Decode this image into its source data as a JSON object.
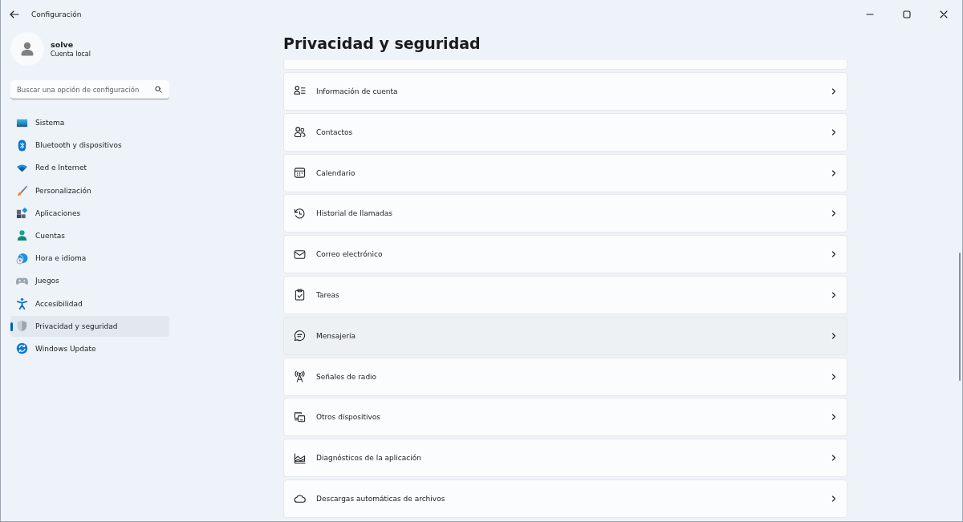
{
  "window": {
    "title": "Configuración"
  },
  "account": {
    "name": "solve",
    "type": "Cuenta local"
  },
  "search": {
    "placeholder": "Buscar una opción de configuración"
  },
  "sidebar": {
    "items": [
      {
        "label": "Sistema",
        "selected": false
      },
      {
        "label": "Bluetooth y dispositivos",
        "selected": false
      },
      {
        "label": "Red e Internet",
        "selected": false
      },
      {
        "label": "Personalización",
        "selected": false
      },
      {
        "label": "Aplicaciones",
        "selected": false
      },
      {
        "label": "Cuentas",
        "selected": false
      },
      {
        "label": "Hora e idioma",
        "selected": false
      },
      {
        "label": "Juegos",
        "selected": false
      },
      {
        "label": "Accesibilidad",
        "selected": false
      },
      {
        "label": "Privacidad y seguridad",
        "selected": true
      },
      {
        "label": "Windows Update",
        "selected": false
      }
    ]
  },
  "page": {
    "title": "Privacidad y seguridad",
    "items": [
      {
        "label": "Información de cuenta",
        "hovered": false
      },
      {
        "label": "Contactos",
        "hovered": false
      },
      {
        "label": "Calendario",
        "hovered": false
      },
      {
        "label": "Historial de llamadas",
        "hovered": false
      },
      {
        "label": "Correo electrónico",
        "hovered": false
      },
      {
        "label": "Tareas",
        "hovered": false
      },
      {
        "label": "Mensajería",
        "hovered": true
      },
      {
        "label": "Señales de radio",
        "hovered": false
      },
      {
        "label": "Otros dispositivos",
        "hovered": false
      },
      {
        "label": "Diagnósticos de la aplicación",
        "hovered": false
      },
      {
        "label": "Descargas automáticas de archivos",
        "hovered": false
      }
    ]
  }
}
